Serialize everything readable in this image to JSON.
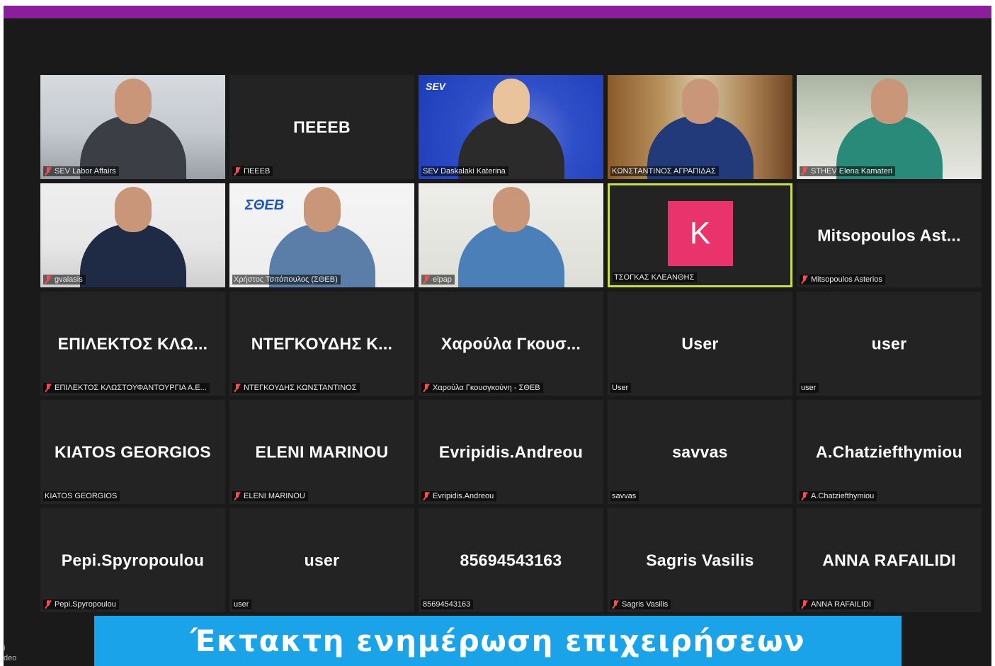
{
  "meeting": {
    "tiles": [
      {
        "name": "SEV Labor Affairs",
        "muted": true,
        "scene": "office1",
        "display": ""
      },
      {
        "name": "ΠΕΕΕΒ",
        "muted": true,
        "scene": "none",
        "display": "ΠΕΕΕΒ"
      },
      {
        "name": "SEV Daskalaki Katerina",
        "muted": false,
        "scene": "blue",
        "display": ""
      },
      {
        "name": "ΚΩΝΣΤΑΝΤΙΝΟΣ ΑΓΡΑΠΙΔΑΣ",
        "muted": false,
        "scene": "wood",
        "display": ""
      },
      {
        "name": "STHEV Elena Kamateri",
        "muted": true,
        "scene": "room",
        "display": ""
      },
      {
        "name": "gvalasis",
        "muted": true,
        "scene": "poster",
        "display": ""
      },
      {
        "name": "Χρήστος Τσιτόπουλος (ΣΘΕΒ)",
        "muted": false,
        "scene": "white",
        "display": ""
      },
      {
        "name": "elpap",
        "muted": true,
        "scene": "light",
        "display": ""
      },
      {
        "name": "ΤΣΟΓΚΑΣ ΚΛΕΑΝΘΗΣ",
        "muted": false,
        "scene": "avatar",
        "display": "",
        "avatar_letter": "K",
        "active": true
      },
      {
        "name": "Mitsopoulos Asterios",
        "muted": true,
        "scene": "none",
        "display": "Mitsopoulos  Ast..."
      },
      {
        "name": "ΕΠΙΛΕΚΤΟΣ ΚΛΩΣΤΟΫΦΑΝΤΟΥΡΓΙΑ Α.Ε...",
        "muted": true,
        "scene": "none",
        "display": "ΕΠΙΛΕΚΤΟΣ  ΚΛΩ..."
      },
      {
        "name": "ΝΤΕΓΚΟΥΔΗΣ ΚΩΝΣΤΑΝΤΙΝΟΣ",
        "muted": true,
        "scene": "none",
        "display": "ΝΤΕΓΚΟΥΔΗΣ  Κ..."
      },
      {
        "name": "Χαρούλα Γκουσγκούνη - ΣΘΕΒ",
        "muted": true,
        "scene": "none",
        "display": "Χαρούλα  Γκουσ..."
      },
      {
        "name": "User",
        "muted": false,
        "scene": "none",
        "display": "User"
      },
      {
        "name": "user",
        "muted": false,
        "scene": "none",
        "display": "user"
      },
      {
        "name": "KIATOS GEORGIOS",
        "muted": false,
        "scene": "none",
        "display": "KIATOS GEORGIOS"
      },
      {
        "name": "ELENI MARINOU",
        "muted": true,
        "scene": "none",
        "display": "ELENI MARINOU"
      },
      {
        "name": "Evripidis.Andreou",
        "muted": true,
        "scene": "none",
        "display": "Evripidis.Andreou"
      },
      {
        "name": "savvas",
        "muted": false,
        "scene": "none",
        "display": "savvas"
      },
      {
        "name": "A.Chatziefthymiou",
        "muted": true,
        "scene": "none",
        "display": "A.Chatziefthymiou"
      },
      {
        "name": "Pepi.Spyropoulou",
        "muted": true,
        "scene": "none",
        "display": "Pepi.Spyropoulou"
      },
      {
        "name": "user",
        "muted": false,
        "scene": "none",
        "display": "user"
      },
      {
        "name": "85694543163",
        "muted": false,
        "scene": "none",
        "display": "85694543163"
      },
      {
        "name": "Sagris Vasilis",
        "muted": true,
        "scene": "none",
        "display": "Sagris Vasilis"
      },
      {
        "name": "ANNA RAFAILIDI",
        "muted": true,
        "scene": "none",
        "display": "ANNA RAFAILIDI"
      }
    ]
  },
  "logos": {
    "sev": "SEV",
    "soeb": "ΣΘΕΒ"
  },
  "side": {
    "line1": "i",
    "line2": "deo"
  },
  "caption": {
    "text": "Έκτακτη ενημέρωση επιχειρήσεων"
  },
  "colors": {
    "topbar": "#8b1e9b",
    "caption_bg": "#1aa3e8",
    "active_border": "#c6e04a",
    "avatar_bg": "#e8336d",
    "muted_icon": "#ff4d4d"
  }
}
